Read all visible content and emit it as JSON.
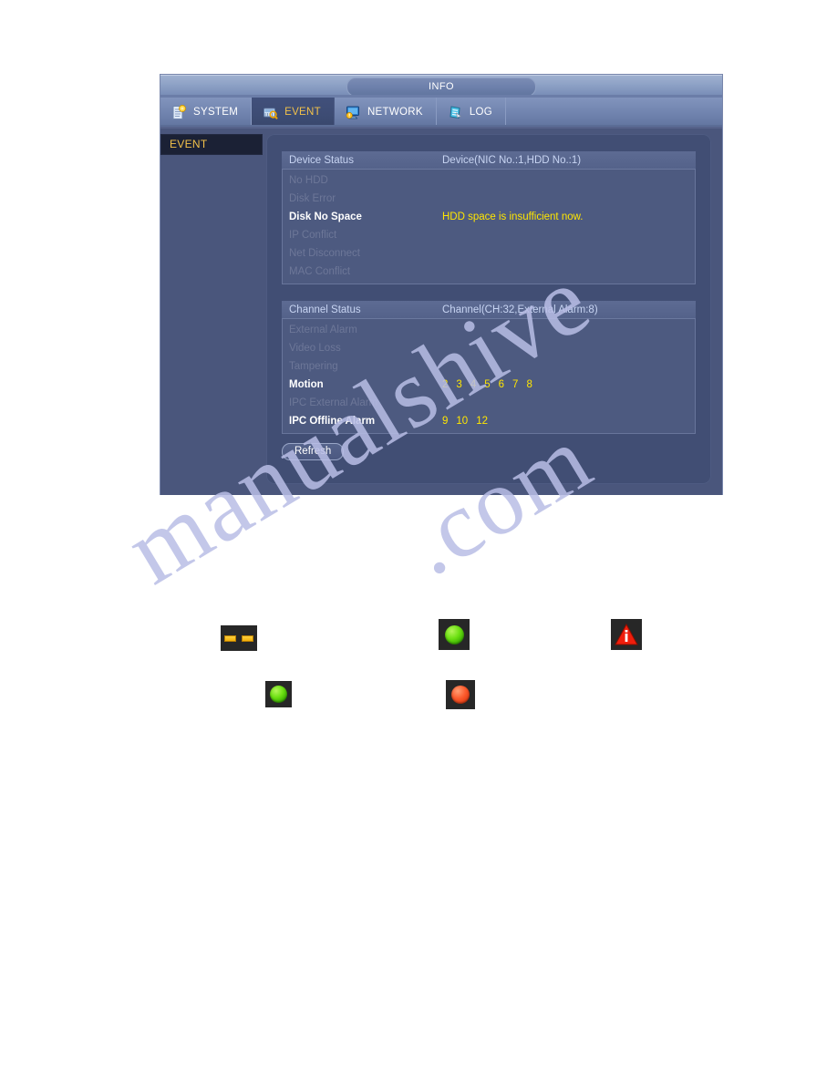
{
  "window": {
    "title": "INFO"
  },
  "tabs": [
    {
      "label": "SYSTEM",
      "icon": "system-icon",
      "active": false
    },
    {
      "label": "EVENT",
      "icon": "event-icon",
      "active": true
    },
    {
      "label": "NETWORK",
      "icon": "network-icon",
      "active": false
    },
    {
      "label": "LOG",
      "icon": "log-icon",
      "active": false
    }
  ],
  "sidebar": {
    "items": [
      {
        "label": "EVENT",
        "selected": true
      }
    ]
  },
  "device_status": {
    "header_left": "Device Status",
    "header_right": "Device(NIC No.:1,HDD No.:1)",
    "rows": [
      {
        "label": "No HDD",
        "value": "",
        "active": false
      },
      {
        "label": "Disk Error",
        "value": "",
        "active": false
      },
      {
        "label": "Disk No Space",
        "value": "HDD space is insufficient now.",
        "active": true
      },
      {
        "label": "IP Conflict",
        "value": "",
        "active": false
      },
      {
        "label": "Net Disconnect",
        "value": "",
        "active": false
      },
      {
        "label": "MAC Conflict",
        "value": "",
        "active": false
      }
    ]
  },
  "channel_status": {
    "header_left": "Channel Status",
    "header_right": "Channel(CH:32,External Alarm:8)",
    "rows": [
      {
        "label": "External Alarm",
        "channels": [],
        "active": false
      },
      {
        "label": "Video Loss",
        "channels": [],
        "active": false
      },
      {
        "label": "Tampering",
        "channels": [],
        "active": false
      },
      {
        "label": "Motion",
        "channels": [
          "2",
          "3",
          "4",
          "5",
          "6",
          "7",
          "8"
        ],
        "active": true
      },
      {
        "label": "IPC External Alarm",
        "channels": [],
        "active": false
      },
      {
        "label": "IPC Offline Alarm",
        "channels": [
          "9",
          "10",
          "12"
        ],
        "active": true
      }
    ]
  },
  "buttons": {
    "refresh": "Refresh"
  },
  "legend_icons": [
    {
      "name": "dashes-icon",
      "kind": "dashes"
    },
    {
      "name": "green-circle-icon",
      "kind": "green"
    },
    {
      "name": "red-warning-triangle-icon",
      "kind": "warning"
    },
    {
      "name": "green-circle-small-icon",
      "kind": "green"
    },
    {
      "name": "red-circle-icon",
      "kind": "red"
    }
  ],
  "watermark": {
    "line_a": "manualshive",
    "line_b": ".com"
  },
  "colors": {
    "accent_yellow": "#ffe600",
    "menu_highlight": "#f2c14a",
    "window_bg": "#434f73",
    "panel_bg": "#414e74",
    "table_bg": "#4d5a80",
    "disabled_text": "#6d7798"
  }
}
